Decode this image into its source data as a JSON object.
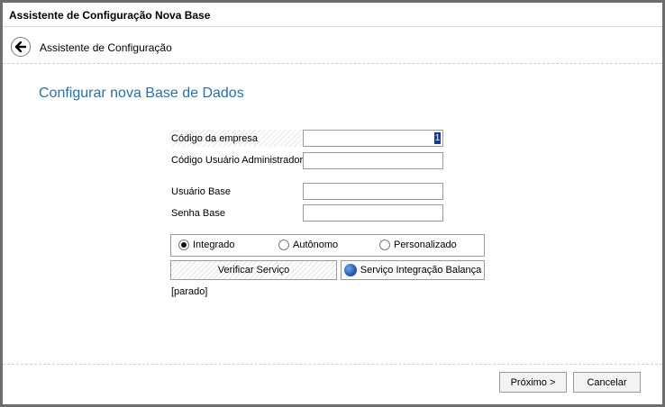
{
  "window": {
    "title": "Assistente de Configuração Nova Base"
  },
  "nav": {
    "title": "Assistente de Configuração",
    "back_icon": "arrow-left-icon"
  },
  "page": {
    "heading": "Configurar nova Base de Dados"
  },
  "form": {
    "codigo_empresa": {
      "label": "Código da empresa",
      "value": ""
    },
    "codigo_admin": {
      "label": "Código Usuário Administrador",
      "value": ""
    },
    "usuario_base": {
      "label": "Usuário Base",
      "value": ""
    },
    "senha_base": {
      "label": "Senha Base",
      "value": ""
    }
  },
  "mode": {
    "options": [
      "Integrado",
      "Autônomo",
      "Personalizado"
    ],
    "selected": "Integrado"
  },
  "buttons": {
    "verificar": "Verificar Serviço",
    "balanca": "Serviço Integração Balança",
    "proximo": "Próximo >",
    "cancelar": "Cancelar"
  },
  "status": "[parado]",
  "colors": {
    "heading": "#2a6fa8",
    "border": "#6d6d6d"
  }
}
